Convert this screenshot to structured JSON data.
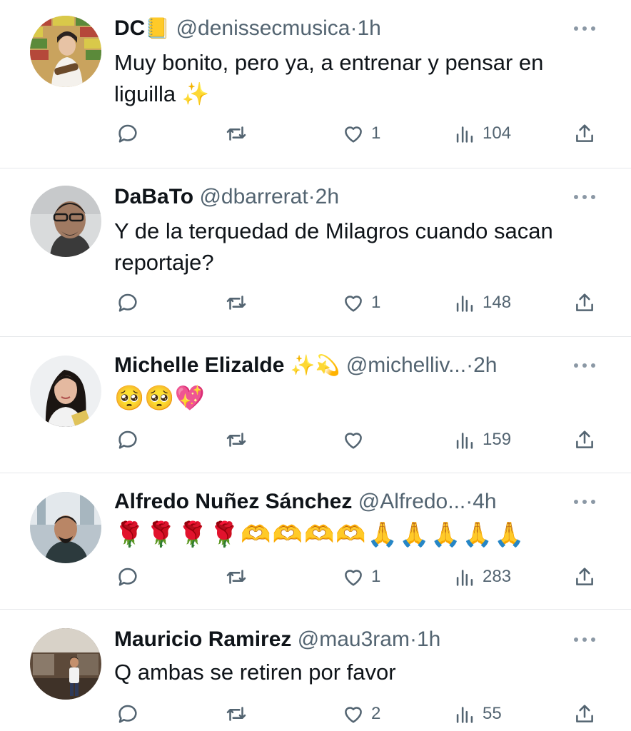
{
  "tweets": [
    {
      "name": "DC",
      "name_emoji": "📒",
      "handle": "@denissecmusica",
      "separator": "·",
      "time": "1h",
      "text": "Muy bonito, pero ya, a entrenar y pensar en liguilla ✨",
      "likes": "1",
      "views": "104",
      "avatar": {
        "bg": "#c9a35e",
        "accent": "#5b8a3a",
        "skin": "#e7c3a5",
        "hair": "#2b2320"
      }
    },
    {
      "name": "DaBaTo",
      "name_emoji": "",
      "handle": "@dbarrerat",
      "separator": "·",
      "time": "2h",
      "text": "Y de la terquedad de Milagros cuando sacan reportaje?",
      "likes": "1",
      "views": "148",
      "avatar": {
        "bg": "#d9dbdc",
        "accent": "#3a3a3a",
        "skin": "#a07a62",
        "hair": "#1f1c1a"
      }
    },
    {
      "name": "Michelle Elizalde",
      "name_emoji": "✨💫",
      "handle": "@michelliv...",
      "separator": "·",
      "time": "2h",
      "text": "🥺🥺💖",
      "likes": "",
      "views": "159",
      "avatar": {
        "bg": "#eef0f2",
        "accent": "#f2f2f2",
        "skin": "#e4b9a0",
        "hair": "#1b1512"
      }
    },
    {
      "name": "Alfredo Nuñez Sánchez",
      "name_emoji": "",
      "handle": "@Alfredo...",
      "separator": "·",
      "time": "4h",
      "text": "🌹🌹🌹🌹🫶🫶🫶🫶🙏🙏🙏🙏🙏",
      "likes": "1",
      "views": "283",
      "avatar": {
        "bg": "#b9c4cc",
        "accent": "#2c3a3d",
        "skin": "#b98666",
        "hair": "#1d1816"
      }
    },
    {
      "name": "Mauricio Ramirez",
      "name_emoji": "",
      "handle": "@mau3ram",
      "separator": "·",
      "time": "1h",
      "text": "Q ambas se retiren por favor",
      "likes": "2",
      "views": "55",
      "avatar": {
        "bg": "#5d4a3a",
        "accent": "#d8d2c8",
        "skin": "#c4906d",
        "hair": "#201a16"
      }
    }
  ]
}
